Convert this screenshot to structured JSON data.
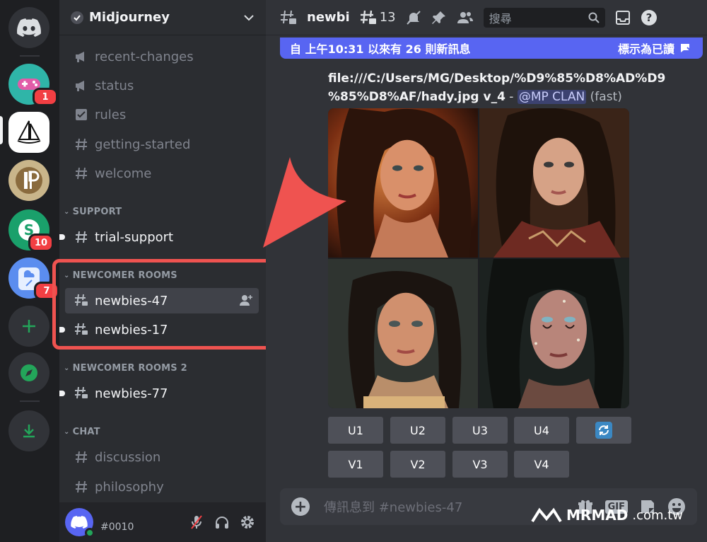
{
  "servers": {
    "badges": [
      "1",
      "10",
      "7"
    ]
  },
  "guild": {
    "name": "Midjourney"
  },
  "channels": [
    {
      "name": "recent-changes",
      "type": "announce"
    },
    {
      "name": "status",
      "type": "announce"
    },
    {
      "name": "rules",
      "type": "rules"
    },
    {
      "name": "getting-started",
      "type": "text"
    },
    {
      "name": "welcome",
      "type": "text"
    }
  ],
  "categories": {
    "support": "SUPPORT",
    "newcomer": "NEWCOMER ROOMS",
    "newcomer2": "NEWCOMER ROOMS 2",
    "chat": "CHAT"
  },
  "support_channels": [
    {
      "name": "trial-support"
    }
  ],
  "newcomer_channels": [
    {
      "name": "newbies-47",
      "active": true
    },
    {
      "name": "newbies-17"
    }
  ],
  "newcomer2_channels": [
    {
      "name": "newbies-77"
    }
  ],
  "chat_channels": [
    {
      "name": "discussion"
    },
    {
      "name": "philosophy"
    }
  ],
  "user": {
    "tag": "#0010"
  },
  "topbar": {
    "title": "newbi",
    "thread_count": "13",
    "search_placeholder": "搜尋"
  },
  "new_messages": {
    "text": "自 上午10:31 以來有 26 則新訊息",
    "mark_read": "標示為已讀"
  },
  "message": {
    "line1": "file:///C:/Users/MG/Desktop/%D9%85%D8%AD%D9",
    "line2": "%85%D8%AF/hady.jpg v_4",
    "sep": " - ",
    "mention": "@MP CLAN",
    "speed": "(fast)"
  },
  "buttons": {
    "upscale": [
      "U1",
      "U2",
      "U3",
      "U4"
    ],
    "variation": [
      "V1",
      "V2",
      "V3",
      "V4"
    ]
  },
  "composer": {
    "placeholder": "傳訊息到 #newbies-47",
    "gif": "GIF"
  },
  "watermark": {
    "brand": "MRMAD",
    "domain": ".com.tw"
  },
  "colors": {
    "accent": "#5865f2",
    "highlight": "#ef5350",
    "danger": "#f23f43",
    "online": "#23a55a"
  }
}
